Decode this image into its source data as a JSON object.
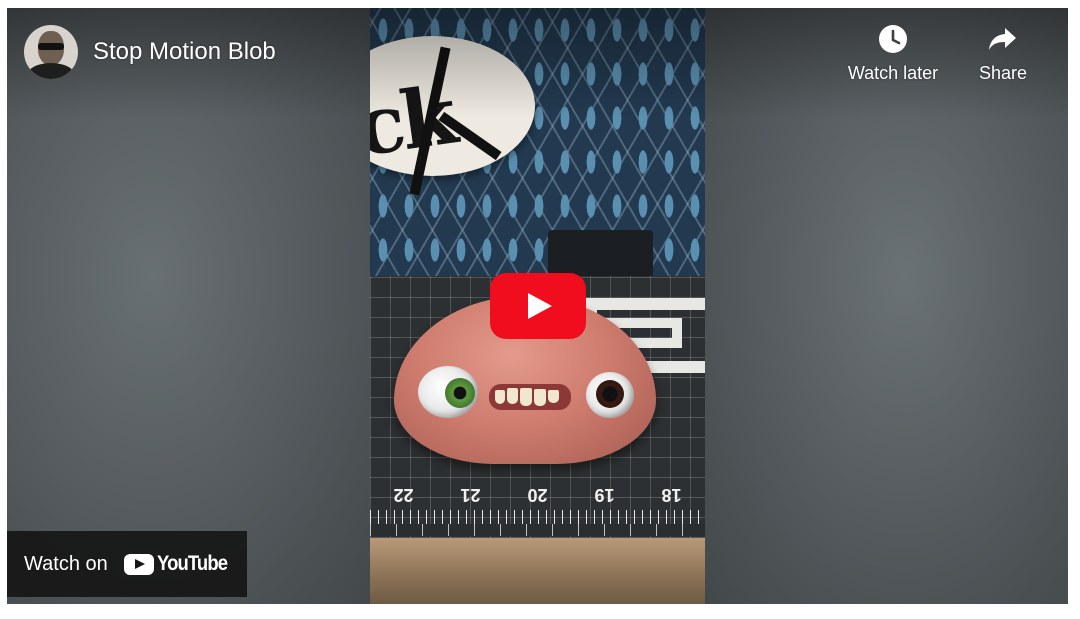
{
  "video": {
    "title": "Stop Motion Blob",
    "channel_avatar": "channel-avatar"
  },
  "actions": {
    "watch_later_label": "Watch later",
    "watch_later_icon": "clock-icon",
    "share_label": "Share",
    "share_icon": "share-arrow-icon"
  },
  "player": {
    "play_icon": "play-icon",
    "play_color": "#f00d1d"
  },
  "watch_on": {
    "label": "Watch on",
    "brand": "YouTube",
    "brand_icon": "youtube-logo-icon"
  },
  "scene": {
    "sign_text": "ick",
    "ruler_numbers": [
      "22",
      "21",
      "20",
      "19",
      "18"
    ]
  }
}
